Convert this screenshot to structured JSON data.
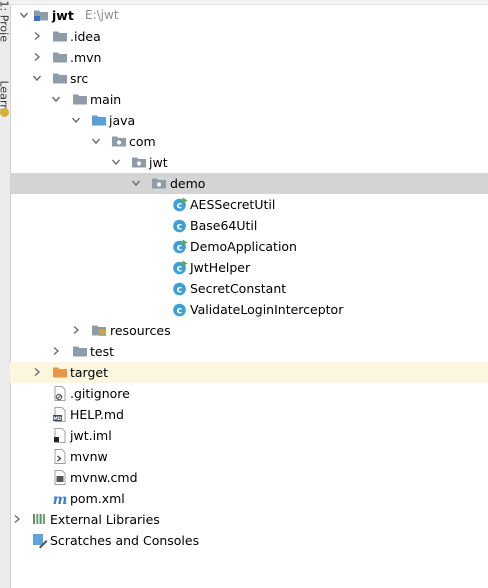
{
  "side_panel": {
    "project_tab": "1: Proje",
    "learn_tab": "Learn"
  },
  "colors": {
    "folder": "#8e9ba8",
    "source_folder": "#5aa0d9",
    "excluded_folder": "#e8974a",
    "class_circle": "#3d9fd6",
    "run_badge": "#5eaa3c",
    "selected_row": "#d4d4d4",
    "excluded_row": "#fbf6dd"
  },
  "tree": {
    "root": {
      "label": "jwt",
      "path": "E:\\jwt",
      "icon": "module-folder-icon"
    },
    "idea": {
      "label": ".idea",
      "icon": "folder-icon"
    },
    "mvn": {
      "label": ".mvn",
      "icon": "folder-icon"
    },
    "src": {
      "label": "src",
      "icon": "folder-icon"
    },
    "main": {
      "label": "main",
      "icon": "folder-icon"
    },
    "java": {
      "label": "java",
      "icon": "source-folder-icon"
    },
    "com": {
      "label": "com",
      "icon": "package-icon"
    },
    "jwt_pkg": {
      "label": "jwt",
      "icon": "package-icon"
    },
    "demo": {
      "label": "demo",
      "icon": "package-icon"
    },
    "classes": [
      {
        "label": "AESSecretUtil",
        "icon": "class-runnable-icon"
      },
      {
        "label": "Base64Util",
        "icon": "class-icon"
      },
      {
        "label": "DemoApplication",
        "icon": "class-runnable-icon"
      },
      {
        "label": "JwtHelper",
        "icon": "class-runnable-icon"
      },
      {
        "label": "SecretConstant",
        "icon": "class-icon"
      },
      {
        "label": "ValidateLoginInterceptor",
        "icon": "class-icon"
      }
    ],
    "resources": {
      "label": "resources",
      "icon": "resources-folder-icon"
    },
    "test": {
      "label": "test",
      "icon": "folder-icon"
    },
    "target": {
      "label": "target",
      "icon": "excluded-folder-icon"
    },
    "files": [
      {
        "label": ".gitignore",
        "icon": "gitignore-file-icon"
      },
      {
        "label": "HELP.md",
        "icon": "markdown-file-icon"
      },
      {
        "label": "jwt.iml",
        "icon": "iml-file-icon"
      },
      {
        "label": "mvnw",
        "icon": "script-file-icon"
      },
      {
        "label": "mvnw.cmd",
        "icon": "cmd-file-icon"
      },
      {
        "label": "pom.xml",
        "icon": "maven-file-icon"
      }
    ],
    "external_libraries": {
      "label": "External Libraries",
      "icon": "libraries-icon"
    },
    "scratches": {
      "label": "Scratches and Consoles",
      "icon": "scratches-icon"
    }
  }
}
